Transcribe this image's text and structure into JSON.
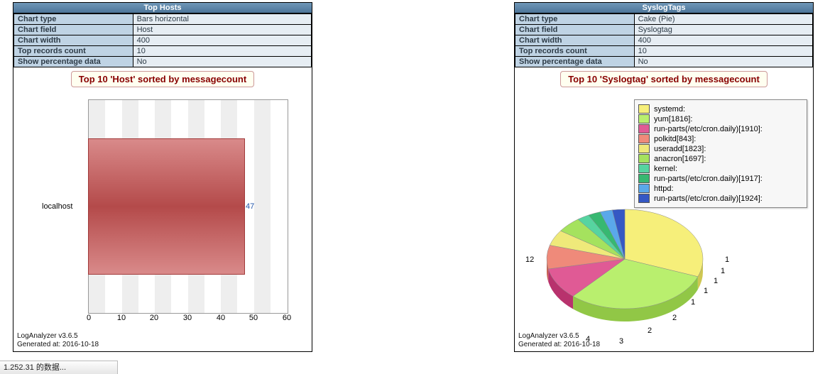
{
  "left": {
    "title": "Top Hosts",
    "props": {
      "type_label": "Chart type",
      "type_value": "Bars horizontal",
      "field_label": "Chart field",
      "field_value": "Host",
      "width_label": "Chart width",
      "width_value": "400",
      "rec_label": "Top records count",
      "rec_value": "10",
      "pct_label": "Show percentage data",
      "pct_value": "No"
    },
    "chart_title": "Top 10 'Host' sorted by messagecount",
    "bar_category": "localhost",
    "bar_value": "47",
    "footer1": "LogAnalyzer v3.6.5",
    "footer2": "Generated at: 2016-10-18",
    "ticks": [
      "0",
      "10",
      "20",
      "30",
      "40",
      "50",
      "60"
    ]
  },
  "right": {
    "title": "SyslogTags",
    "props": {
      "type_label": "Chart type",
      "type_value": "Cake (Pie)",
      "field_label": "Chart field",
      "field_value": "Syslogtag",
      "width_label": "Chart width",
      "width_value": "400",
      "rec_label": "Top records count",
      "rec_value": "10",
      "pct_label": "Show percentage data",
      "pct_value": "No"
    },
    "chart_title": "Top 10 'Syslogtag' sorted by messagecount",
    "legend": {
      "l0": "systemd:",
      "l1": "yum[1816]:",
      "l2": "run-parts(/etc/cron.daily)[1910]:",
      "l3": "polkitd[843]:",
      "l4": "useradd[1823]:",
      "l5": "anacron[1697]:",
      "l6": "kernel:",
      "l7": "run-parts(/etc/cron.daily)[1917]:",
      "l8": "httpd:",
      "l9": "run-parts(/etc/cron.daily)[1924]:"
    },
    "values": {
      "v0": "12",
      "v1": "4",
      "v2": "3",
      "v3": "2",
      "v4": "2",
      "v5": "1",
      "v6": "1",
      "v7": "1",
      "v8": "1",
      "v9": "1"
    },
    "footer1": "LogAnalyzer v3.6.5",
    "footer2": "Generated at: 2016-10-18"
  },
  "status": "1.252.31 的数据...",
  "chart_data": [
    {
      "type": "bar",
      "orientation": "horizontal",
      "title": "Top 10 'Host' sorted by messagecount",
      "categories": [
        "localhost"
      ],
      "values": [
        47
      ],
      "xlim": [
        0,
        60
      ],
      "xticks": [
        0,
        10,
        20,
        30,
        40,
        50,
        60
      ]
    },
    {
      "type": "pie",
      "title": "Top 10 'Syslogtag' sorted by messagecount",
      "series": [
        {
          "name": "systemd:",
          "value": 12,
          "color": "#f6ef7a"
        },
        {
          "name": "yum[1816]:",
          "value": 12,
          "color": "#b9ef6e"
        },
        {
          "name": "run-parts(/etc/cron.daily)[1910]:",
          "value": 4,
          "color": "#e05a95"
        },
        {
          "name": "polkitd[843]:",
          "value": 3,
          "color": "#ef8a7a"
        },
        {
          "name": "useradd[1823]:",
          "value": 2,
          "color": "#efe97a"
        },
        {
          "name": "anacron[1697]:",
          "value": 2,
          "color": "#a5e25e"
        },
        {
          "name": "kernel:",
          "value": 1,
          "color": "#56d4a0"
        },
        {
          "name": "run-parts(/etc/cron.daily)[1917]:",
          "value": 1,
          "color": "#37b871"
        },
        {
          "name": "httpd:",
          "value": 1,
          "color": "#5aa8ea"
        },
        {
          "name": "run-parts(/etc/cron.daily)[1924]:",
          "value": 1,
          "color": "#3558c4"
        }
      ]
    }
  ]
}
